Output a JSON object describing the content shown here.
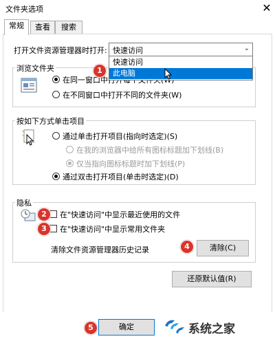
{
  "window": {
    "title": "文件夹选项",
    "close_glyph": "✕"
  },
  "tabs": [
    {
      "label": "常规"
    },
    {
      "label": "查看"
    },
    {
      "label": "搜索"
    }
  ],
  "open_explorer": {
    "label": "打开文件资源管理器时打开:",
    "selected": "快速访问",
    "options": [
      "快速访问",
      "此电脑"
    ],
    "highlighted_option": "此电脑"
  },
  "browse_folders": {
    "title": "浏览文件夹",
    "option_same": "在同一窗口中打开每个文件夹",
    "option_same_suffix": "(W)",
    "option_new": "在不同窗口中打开不同的文件夹(W)"
  },
  "click_items": {
    "title": "按如下方式单击项目",
    "single_click": "通过单击打开项目(指向时选定)(S)",
    "underline_all": "在我的浏览器中给所有图标标题加下划线(B)",
    "underline_point": "仅当指向图标标题时加下划线(P)",
    "double_click": "通过双击打开项目(单击时选定)(D)"
  },
  "privacy": {
    "title": "隐私",
    "recent_files": "在\"快速访问\"中显示最近使用的文件",
    "frequent_folders": "在\"快速访问\"中显示常用文件夹",
    "clear_label": "清除文件资源管理器历史记录",
    "clear_button": "清除(C)"
  },
  "restore_defaults": "还原默认值(R)",
  "ok_button": "确定",
  "badges": [
    "1",
    "2",
    "3",
    "4",
    "5"
  ],
  "watermark": {
    "text": "系统之家"
  },
  "colors": {
    "accent": "#0078d7",
    "badge": "#d9342b"
  }
}
